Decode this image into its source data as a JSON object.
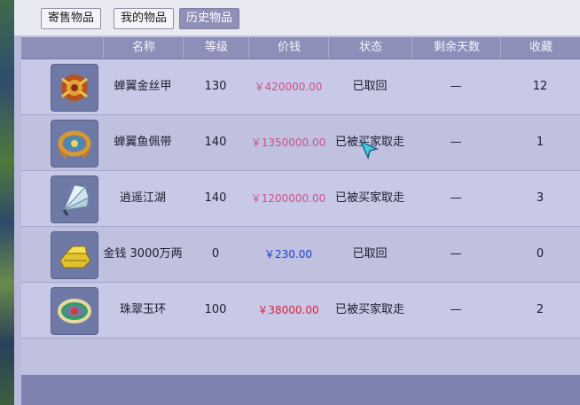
{
  "tabs": [
    {
      "label": "寄售物品"
    },
    {
      "label": "我的物品"
    },
    {
      "label": "历史物品",
      "active": true
    }
  ],
  "columns": [
    "名称",
    "等级",
    "价钱",
    "状态",
    "剩余天数",
    "收藏"
  ],
  "items": [
    {
      "icon": "armor-icon",
      "name": "蝉翼金丝甲",
      "level": "130",
      "price": "￥420000.00",
      "price_color": "#d0508a",
      "status": "已取回",
      "days": "—",
      "favorites": "12"
    },
    {
      "icon": "belt-icon",
      "name": "蝉翼鱼佩带",
      "level": "140",
      "price": "￥1350000.00",
      "price_color": "#d0508a",
      "status": "已被买家取走",
      "days": "—",
      "favorites": "1"
    },
    {
      "icon": "fan-icon",
      "name": "逍遥江湖",
      "level": "140",
      "price": "￥1200000.00",
      "price_color": "#d0508a",
      "status": "已被买家取走",
      "days": "—",
      "favorites": "3"
    },
    {
      "icon": "gold-ingot-icon",
      "name": "金钱 3000万两",
      "level": "0",
      "price": "￥230.00",
      "price_color": "#1f3fd0",
      "status": "已取回",
      "days": "—",
      "favorites": "0"
    },
    {
      "icon": "jade-ring-icon",
      "name": "珠翠玉环",
      "level": "100",
      "price": "￥38000.00",
      "price_color": "#e0203a",
      "status": "已被买家取走",
      "days": "—",
      "favorites": "2"
    }
  ],
  "colors": {
    "header_bg": "#8d8fb8",
    "panel_bg": "#bfc1df",
    "footer_bg": "#7e82b1"
  }
}
